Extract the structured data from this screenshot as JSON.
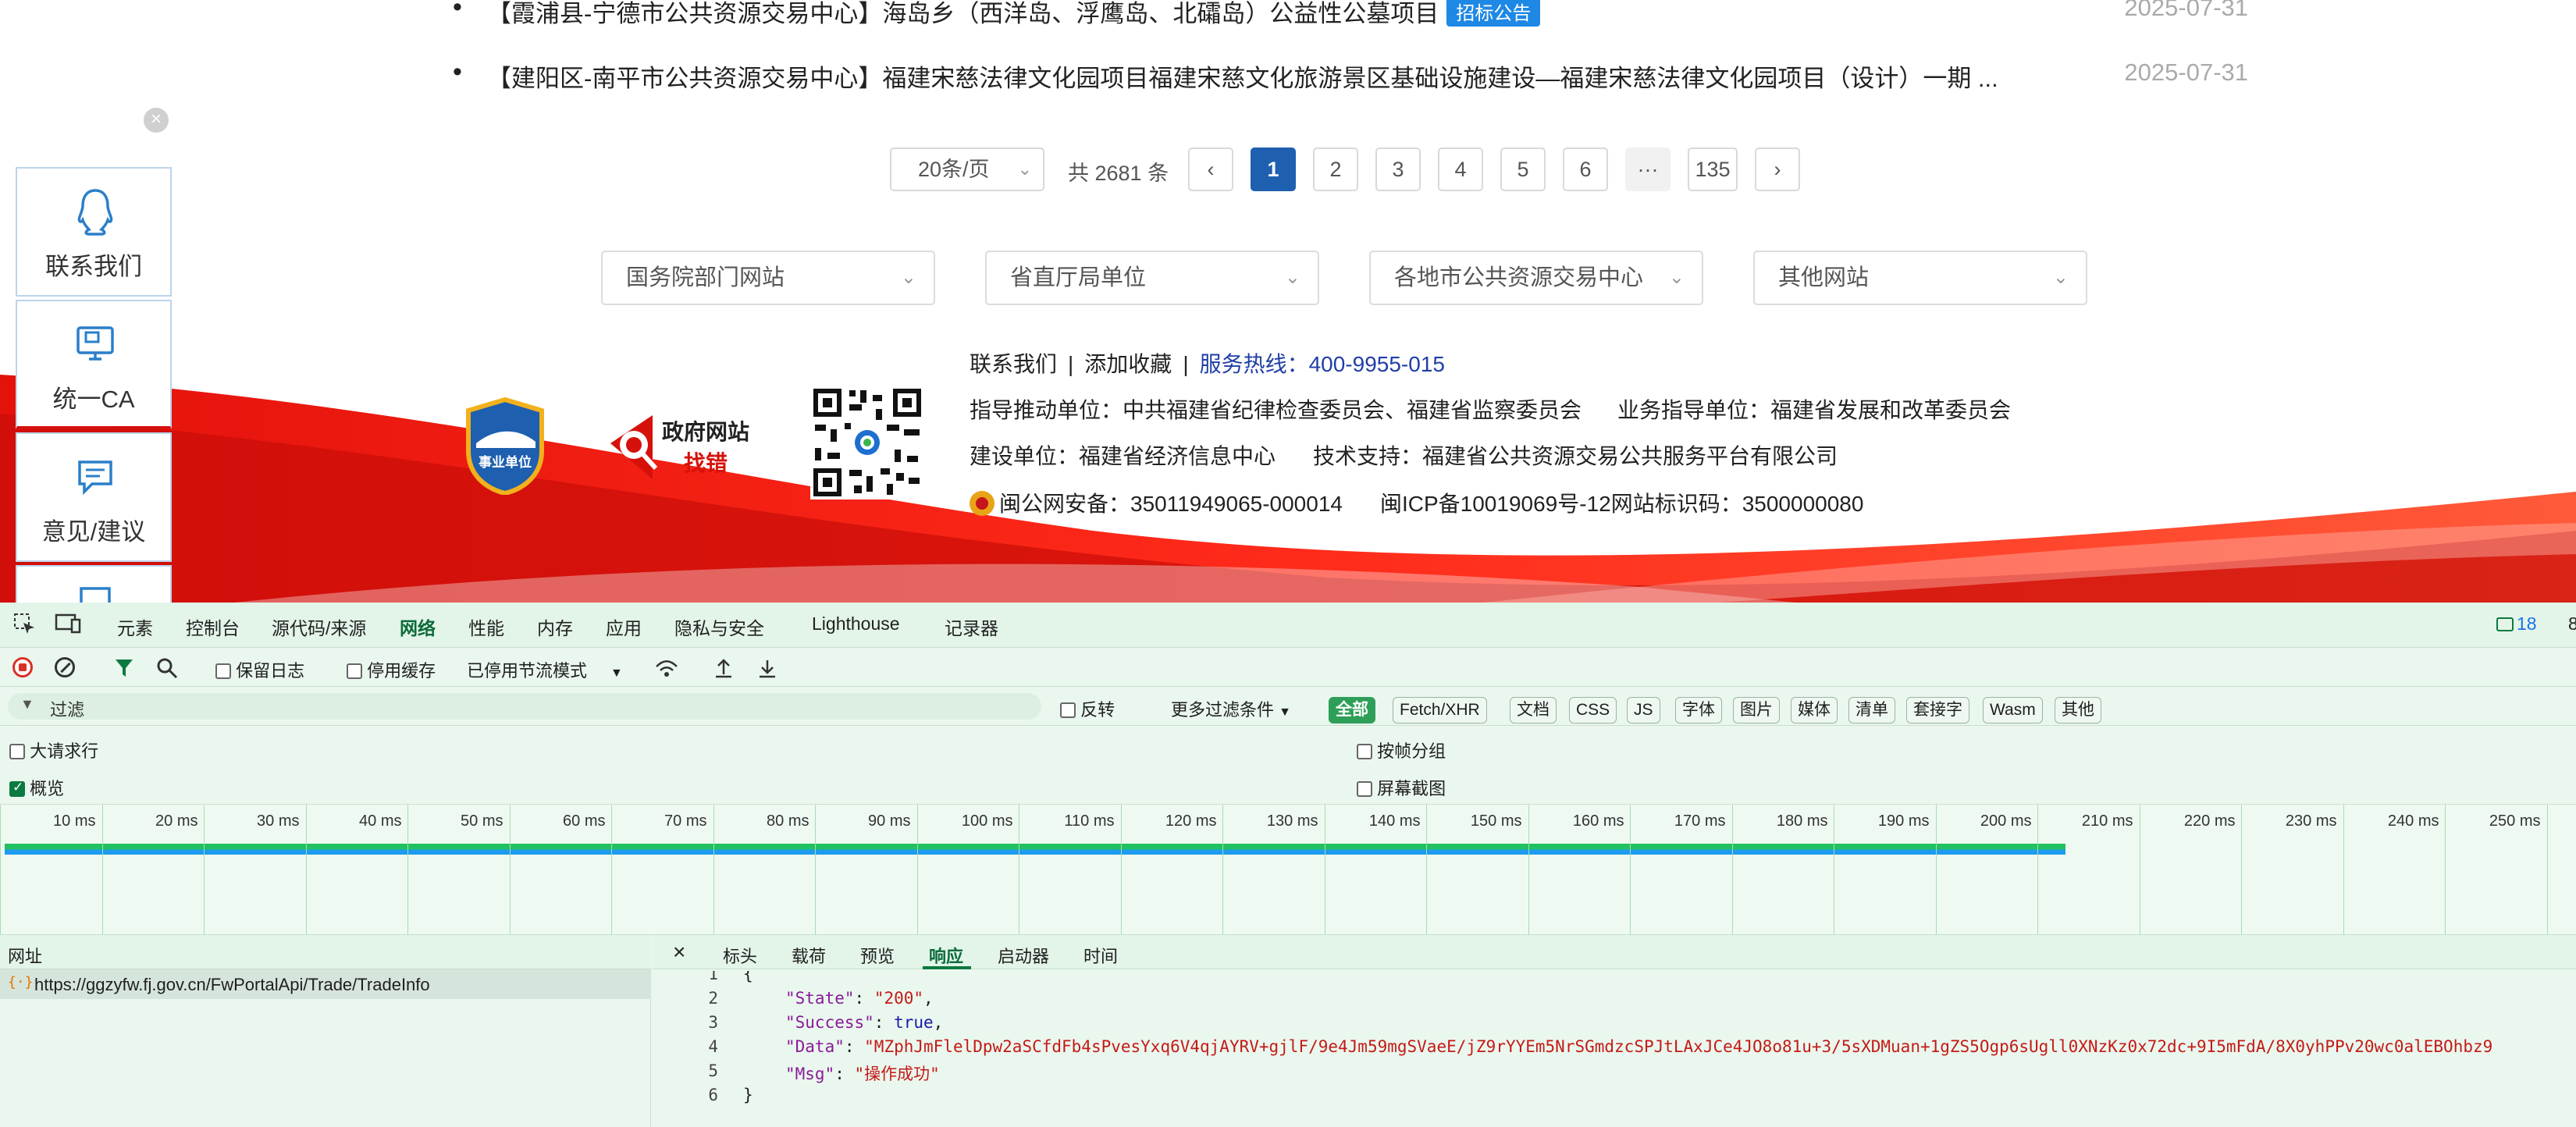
{
  "news": [
    {
      "title": "【霞浦县-宁德市公共资源交易中心】海岛乡（西洋岛、浮鹰岛、北礵岛）公益性公墓项目",
      "tag": "招标公告",
      "date": "2025-07-31"
    },
    {
      "title": "【建阳区-南平市公共资源交易中心】福建宋慈法律文化园项目福建宋慈文化旅游景区基础设施建设—福建宋慈法律文化园项目（设计）一期 ...",
      "tag": "",
      "date": "2025-07-31"
    }
  ],
  "pagination": {
    "page_size": "20条/页",
    "total": "共 2681 条",
    "prev": "‹",
    "next": "›",
    "pages": [
      "1",
      "2",
      "3",
      "4",
      "5",
      "6"
    ],
    "ellipsis": "···",
    "last": "135",
    "current": "1"
  },
  "link_selects": [
    "国务院部门网站",
    "省直厅局单位",
    "各地市公共资源交易中心",
    "其他网站"
  ],
  "footer": {
    "contact": "联系我们",
    "favorite": "添加收藏",
    "hotline": "服务热线：400-9955-015",
    "guide_unit": "指导推动单位：中共福建省纪律检查委员会、福建省监察委员会",
    "business_unit": "业务指导单位：福建省发展和改革委员会",
    "build_unit": "建设单位：福建省经济信息中心",
    "tech_support": "技术支持：福建省公共资源交易公共服务平台有限公司",
    "police_record": "闽公网安备：35011949065-000014",
    "icp": "闽ICP备10019069号-12网站标识码：3500000080",
    "badge_text": "事业单位",
    "findbug_line1": "政府网站",
    "findbug_line2": "找错"
  },
  "sidebar": [
    {
      "label": "联系我们",
      "icon": "qq-icon"
    },
    {
      "label": "统一CA",
      "icon": "ca-monitor-icon"
    },
    {
      "label": "意见/建议",
      "icon": "feedback-icon"
    }
  ],
  "devtools": {
    "tabs": [
      "元素",
      "控制台",
      "源代码/来源",
      "网络",
      "性能",
      "内存",
      "应用",
      "隐私与安全",
      "Lighthouse",
      "记录器"
    ],
    "active_tab": "网络",
    "issues_count": "18",
    "toolbar": {
      "preserve_log": "保留日志",
      "disable_cache": "停用缓存",
      "throttle": "已停用节流模式"
    },
    "filter": {
      "placeholder": "过滤",
      "invert": "反转",
      "more_filters": "更多过滤条件",
      "types": [
        "全部",
        "Fetch/XHR",
        "文档",
        "CSS",
        "JS",
        "字体",
        "图片",
        "媒体",
        "清单",
        "套接字",
        "Wasm",
        "其他"
      ],
      "active_type": "全部"
    },
    "options": {
      "big_rows": "大请求行",
      "overview": "概览",
      "group_by_frame": "按帧分组",
      "screenshots": "屏幕截图"
    },
    "timeline_ticks": [
      "10 ms",
      "20 ms",
      "30 ms",
      "40 ms",
      "50 ms",
      "60 ms",
      "70 ms",
      "80 ms",
      "90 ms",
      "100 ms",
      "110 ms",
      "120 ms",
      "130 ms",
      "140 ms",
      "150 ms",
      "160 ms",
      "170 ms",
      "180 ms",
      "190 ms",
      "200 ms",
      "210 ms",
      "220 ms",
      "230 ms",
      "240 ms",
      "250 ms"
    ],
    "request_list_header": "网址",
    "request_url": "https://ggzyfw.fj.gov.cn/FwPortalApi/Trade/TradeInfo",
    "detail_tabs": [
      "标头",
      "载荷",
      "预览",
      "响应",
      "启动器",
      "时间"
    ],
    "active_detail_tab": "响应",
    "response": {
      "line_numbers": [
        "1",
        "2",
        "3",
        "4",
        "5",
        "6"
      ],
      "open_brace": "{",
      "close_brace": "}",
      "state_key": "\"State\"",
      "state_val": "\"200\"",
      "success_key": "\"Success\"",
      "success_val": "true",
      "data_key": "\"Data\"",
      "data_val": "\"MZphJmFlelDpw2aSCfdFb4sPvesYxq6V4qjAYRV+gjlF/9e4Jm59mgSVaeE/jZ9rYYEm5NrSGmdzcSPJtLAxJCe4JO8o81u+3/5sXDMuan+1gZS5Ogp6sUgll0XNzKz0x72dc+9I5mFdA/8X0yhPPv20wc0alEBOhbz9",
      "msg_key": "\"Msg\"",
      "msg_val": "\"操作成功\""
    }
  }
}
